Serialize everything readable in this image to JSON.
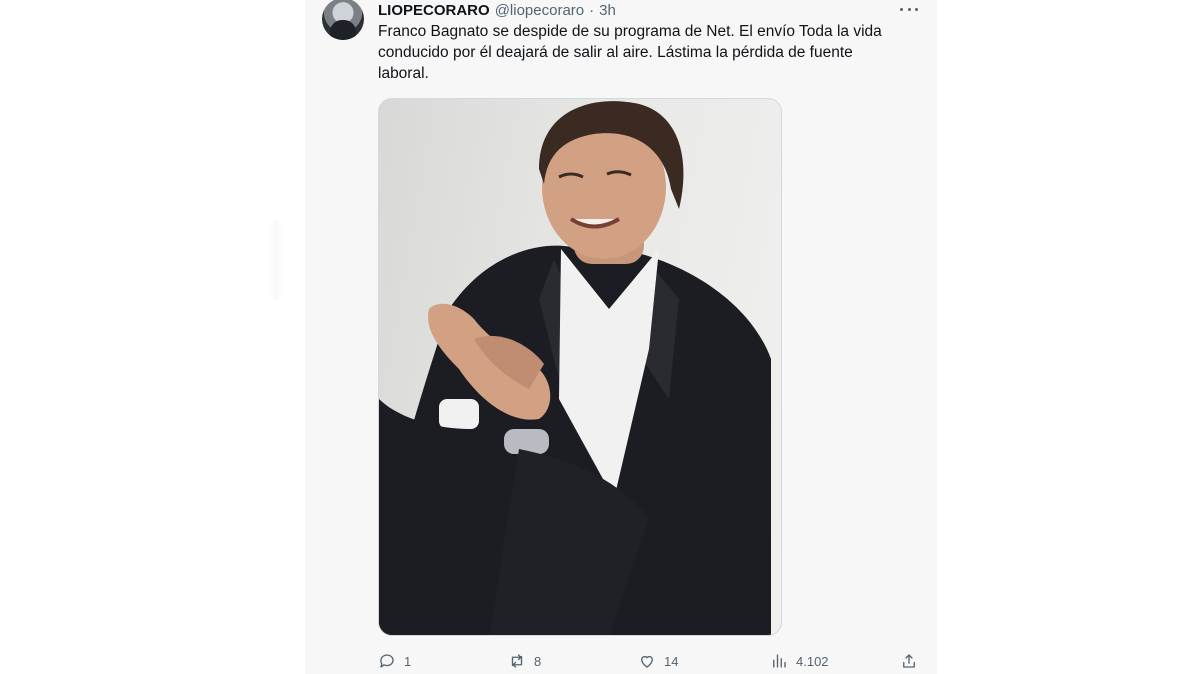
{
  "tweet": {
    "author_name": "LIOPECORARO",
    "handle": "@liopecoraro",
    "separator": "·",
    "time": "3h",
    "text_lines": [
      "Franco Bagnato se despide de su programa de Net. El envío Toda la vida",
      "conducido por él deajará de salir al aire. Lástima la pérdida de fuente",
      "laboral."
    ],
    "media": {
      "description_icon": "photo-of-man-in-suit"
    },
    "actions": {
      "replies": "1",
      "retweets": "8",
      "likes": "14",
      "views": "4.102"
    }
  },
  "colors": {
    "secondary_text": "#536471",
    "primary_text": "#0f1419",
    "card_bg": "#f7f7f7"
  }
}
